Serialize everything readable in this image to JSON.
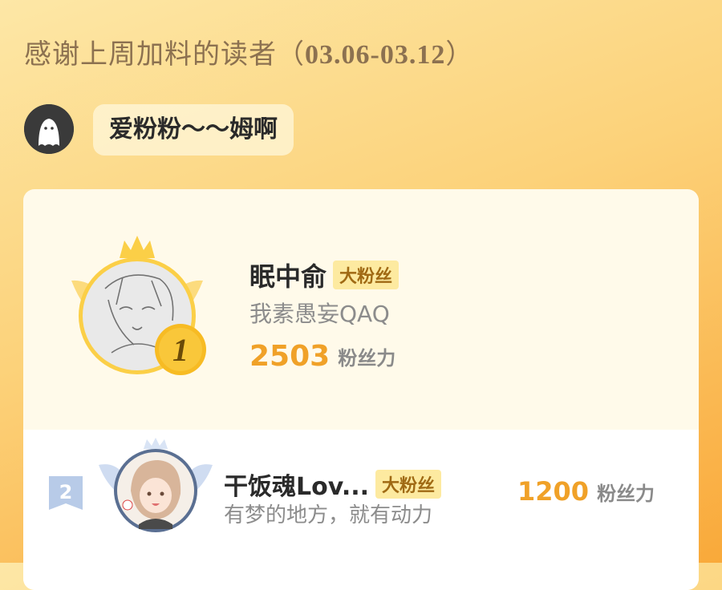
{
  "header": {
    "title_text": "感谢上周加料的读者（",
    "title_date": "03.06-03.12",
    "title_close": "）"
  },
  "author": {
    "name": "爱粉粉～～姆啊",
    "avatar_icon": "ghost-avatar-icon"
  },
  "ranking": [
    {
      "rank": "1",
      "name": "眠中俞",
      "tag": "大粉丝",
      "motto": "我素愚妄QAQ",
      "score": "2503",
      "unit": "粉丝力"
    },
    {
      "rank": "2",
      "name": "干饭魂Lov...",
      "tag": "大粉丝",
      "motto": "有梦的地方，就有动力",
      "score": "1200",
      "unit": "粉丝力"
    }
  ],
  "colors": {
    "accent_gold": "#f0a128",
    "tag_bg": "#fdeaa0",
    "background_top": "#fde7a6",
    "background_bottom": "#f9a93a"
  }
}
